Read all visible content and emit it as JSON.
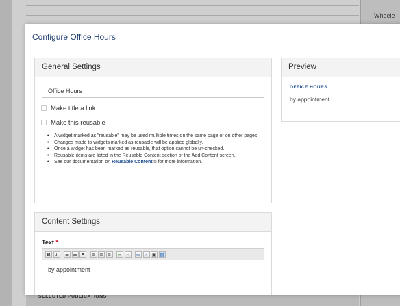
{
  "background": {
    "right_column_text": "Wheele",
    "bottom_heading": "SELECTED PUBLICATIONS"
  },
  "modal": {
    "title": "Configure Office Hours"
  },
  "general_settings": {
    "header": "General Settings",
    "title_input_value": "Office Hours",
    "make_link_label": "Make title a link",
    "make_link_checked": false,
    "reusable_label": "Make this reusable",
    "reusable_checked": false,
    "help": [
      "A widget marked as \"reusable\" may be used multiple times on the same page or on other pages.",
      "Changes made to widgets marked as reusable will be applied globally.",
      "Once a widget has been marked as reusable, that option cannot be un-checked.",
      "Reusable items are listed in the Reusable Content section of the Add Content screen."
    ],
    "help_last_prefix": "See our documentation on ",
    "help_last_link": "Reusable Content",
    "help_last_suffix": " for more information."
  },
  "content_settings": {
    "header": "Content Settings",
    "text_label": "Text",
    "required_mark": "*",
    "toolbar_icons": [
      "bold-icon",
      "italic-icon",
      "bulleted-list-icon",
      "numbered-list-icon",
      "blockquote-icon",
      "align-left-icon",
      "align-center-icon",
      "align-right-icon",
      "link-icon",
      "unlink-icon",
      "paste-icon",
      "spellcheck-icon",
      "image-icon",
      "source-icon"
    ],
    "editor_text": "by appointment"
  },
  "preview": {
    "header": "Preview",
    "heading": "OFFICE HOURS",
    "text": "by appointment"
  },
  "colors": {
    "title": "#1f3f6e",
    "link": "#1f4e8f",
    "required": "#d0021b",
    "overlay": "#b3b3b3"
  }
}
